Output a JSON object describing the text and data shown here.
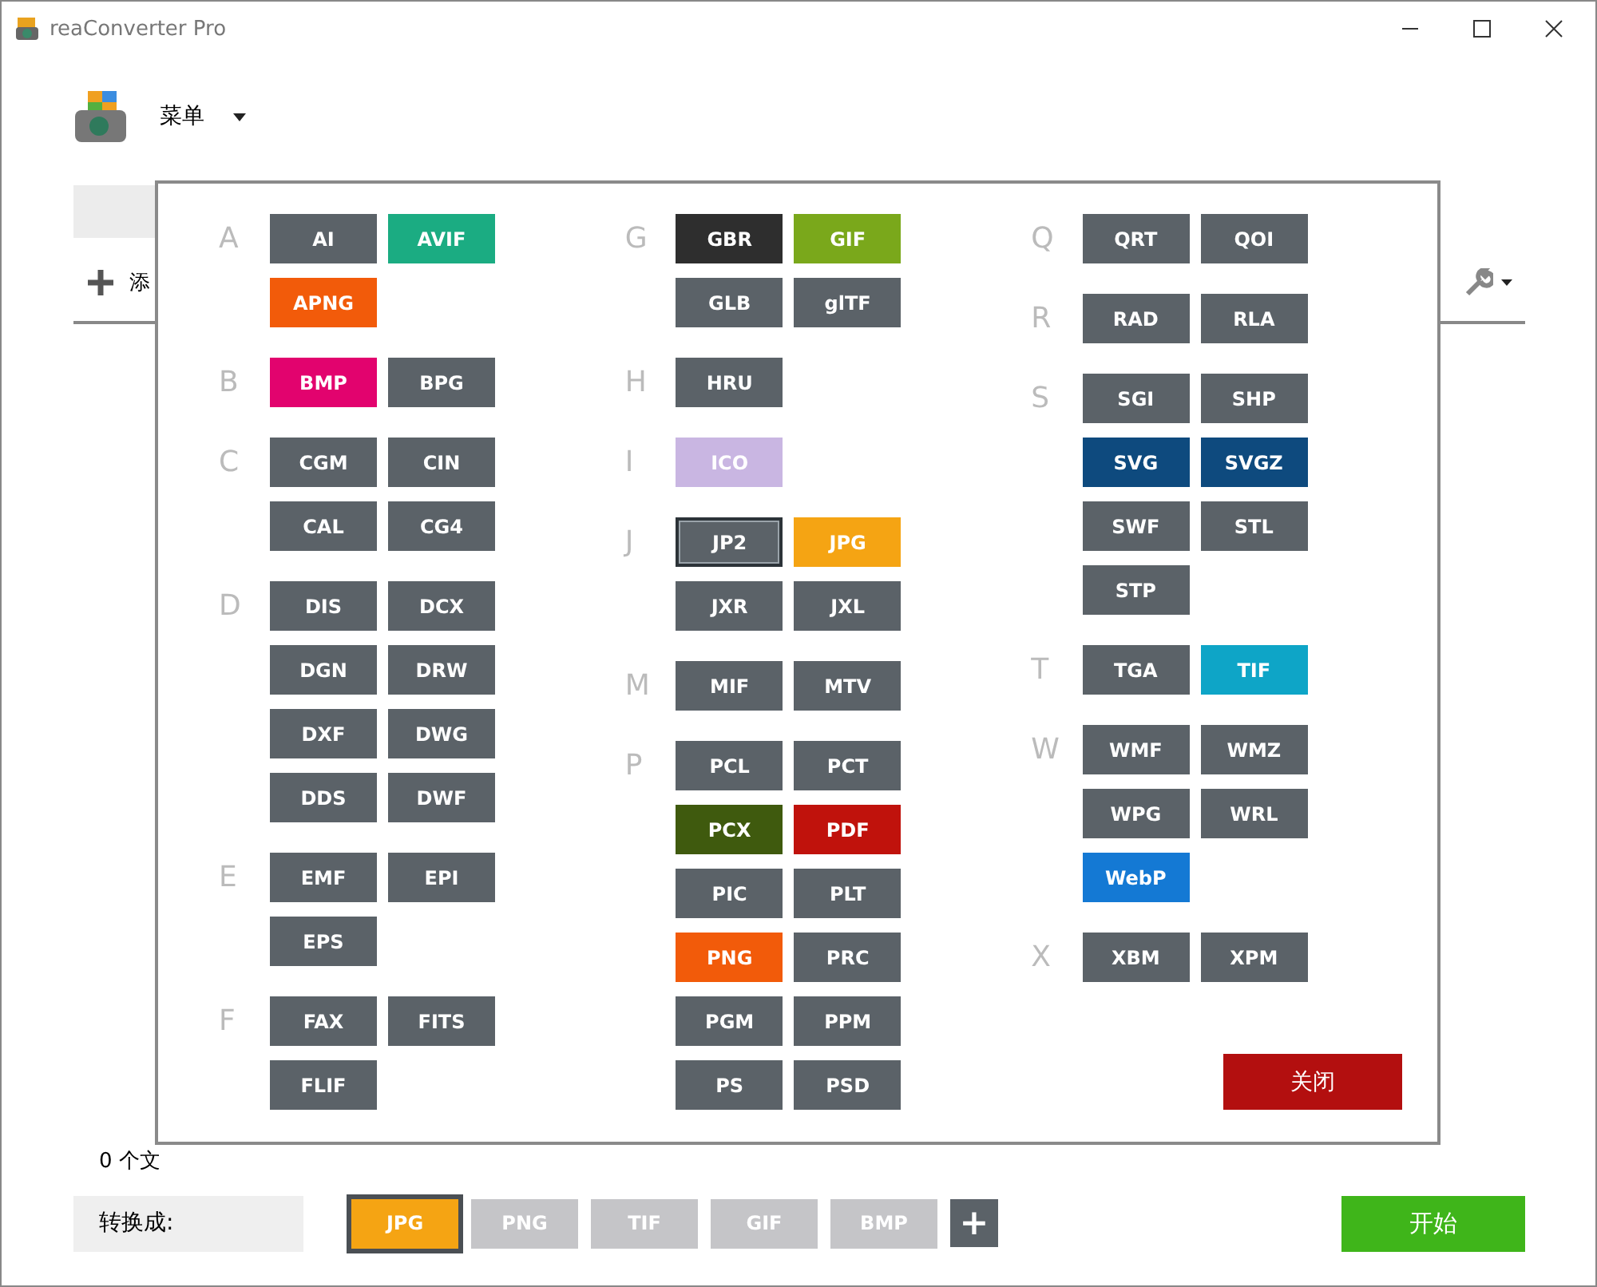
{
  "window": {
    "title": "reaConverter Pro"
  },
  "menu": {
    "label": "菜单"
  },
  "toolbar": {
    "add_label": "添"
  },
  "status": {
    "text": "0 个文"
  },
  "popup": {
    "columns": [
      [
        {
          "letter": "A",
          "formats": [
            {
              "label": "AI",
              "color": "#5b6268",
              "selected": false
            },
            {
              "label": "AVIF",
              "color": "#1bac82",
              "selected": false
            },
            {
              "label": "APNG",
              "color": "#f25b0a",
              "selected": false
            }
          ]
        },
        {
          "letter": "B",
          "formats": [
            {
              "label": "BMP",
              "color": "#e2036e",
              "selected": false
            },
            {
              "label": "BPG",
              "color": "#5b6268",
              "selected": false
            }
          ]
        },
        {
          "letter": "C",
          "formats": [
            {
              "label": "CGM",
              "color": "#5b6268",
              "selected": false
            },
            {
              "label": "CIN",
              "color": "#5b6268",
              "selected": false
            },
            {
              "label": "CAL",
              "color": "#5b6268",
              "selected": false
            },
            {
              "label": "CG4",
              "color": "#5b6268",
              "selected": false
            }
          ]
        },
        {
          "letter": "D",
          "formats": [
            {
              "label": "DIS",
              "color": "#5b6268",
              "selected": false
            },
            {
              "label": "DCX",
              "color": "#5b6268",
              "selected": false
            },
            {
              "label": "DGN",
              "color": "#5b6268",
              "selected": false
            },
            {
              "label": "DRW",
              "color": "#5b6268",
              "selected": false
            },
            {
              "label": "DXF",
              "color": "#5b6268",
              "selected": false
            },
            {
              "label": "DWG",
              "color": "#5b6268",
              "selected": false
            },
            {
              "label": "DDS",
              "color": "#5b6268",
              "selected": false
            },
            {
              "label": "DWF",
              "color": "#5b6268",
              "selected": false
            }
          ]
        },
        {
          "letter": "E",
          "formats": [
            {
              "label": "EMF",
              "color": "#5b6268",
              "selected": false
            },
            {
              "label": "EPI",
              "color": "#5b6268",
              "selected": false
            },
            {
              "label": "EPS",
              "color": "#5b6268",
              "selected": false
            }
          ]
        },
        {
          "letter": "F",
          "formats": [
            {
              "label": "FAX",
              "color": "#5b6268",
              "selected": false
            },
            {
              "label": "FITS",
              "color": "#5b6268",
              "selected": false
            },
            {
              "label": "FLIF",
              "color": "#5b6268",
              "selected": false
            }
          ]
        }
      ],
      [
        {
          "letter": "G",
          "formats": [
            {
              "label": "GBR",
              "color": "#2e2e2e",
              "selected": false
            },
            {
              "label": "GIF",
              "color": "#7aa81b",
              "selected": false
            },
            {
              "label": "GLB",
              "color": "#5b6268",
              "selected": false
            },
            {
              "label": "glTF",
              "color": "#5b6268",
              "selected": false
            }
          ]
        },
        {
          "letter": "H",
          "formats": [
            {
              "label": "HRU",
              "color": "#5b6268",
              "selected": false
            }
          ]
        },
        {
          "letter": "I",
          "formats": [
            {
              "label": "ICO",
              "color": "#c9b6e2",
              "selected": false
            }
          ]
        },
        {
          "letter": "J",
          "formats": [
            {
              "label": "JP2",
              "color": "#5b6268",
              "selected": true
            },
            {
              "label": "JPG",
              "color": "#f5a413",
              "selected": false
            },
            {
              "label": "JXR",
              "color": "#5b6268",
              "selected": false
            },
            {
              "label": "JXL",
              "color": "#5b6268",
              "selected": false
            }
          ]
        },
        {
          "letter": "M",
          "formats": [
            {
              "label": "MIF",
              "color": "#5b6268",
              "selected": false
            },
            {
              "label": "MTV",
              "color": "#5b6268",
              "selected": false
            }
          ]
        },
        {
          "letter": "P",
          "formats": [
            {
              "label": "PCL",
              "color": "#5b6268",
              "selected": false
            },
            {
              "label": "PCT",
              "color": "#5b6268",
              "selected": false
            },
            {
              "label": "PCX",
              "color": "#3f5a0e",
              "selected": false
            },
            {
              "label": "PDF",
              "color": "#c0120c",
              "selected": false
            },
            {
              "label": "PIC",
              "color": "#5b6268",
              "selected": false
            },
            {
              "label": "PLT",
              "color": "#5b6268",
              "selected": false
            },
            {
              "label": "PNG",
              "color": "#f25b0a",
              "selected": false
            },
            {
              "label": "PRC",
              "color": "#5b6268",
              "selected": false
            },
            {
              "label": "PGM",
              "color": "#5b6268",
              "selected": false
            },
            {
              "label": "PPM",
              "color": "#5b6268",
              "selected": false
            },
            {
              "label": "PS",
              "color": "#5b6268",
              "selected": false
            },
            {
              "label": "PSD",
              "color": "#5b6268",
              "selected": false
            }
          ]
        }
      ],
      [
        {
          "letter": "Q",
          "formats": [
            {
              "label": "QRT",
              "color": "#5b6268",
              "selected": false
            },
            {
              "label": "QOI",
              "color": "#5b6268",
              "selected": false
            }
          ]
        },
        {
          "letter": "R",
          "formats": [
            {
              "label": "RAD",
              "color": "#5b6268",
              "selected": false
            },
            {
              "label": "RLA",
              "color": "#5b6268",
              "selected": false
            }
          ]
        },
        {
          "letter": "S",
          "formats": [
            {
              "label": "SGI",
              "color": "#5b6268",
              "selected": false
            },
            {
              "label": "SHP",
              "color": "#5b6268",
              "selected": false
            },
            {
              "label": "SVG",
              "color": "#0e4a7e",
              "selected": false
            },
            {
              "label": "SVGZ",
              "color": "#0e4a7e",
              "selected": false
            },
            {
              "label": "SWF",
              "color": "#5b6268",
              "selected": false
            },
            {
              "label": "STL",
              "color": "#5b6268",
              "selected": false
            },
            {
              "label": "STP",
              "color": "#5b6268",
              "selected": false
            }
          ]
        },
        {
          "letter": "T",
          "formats": [
            {
              "label": "TGA",
              "color": "#5b6268",
              "selected": false
            },
            {
              "label": "TIF",
              "color": "#0ea5c7",
              "selected": false
            }
          ]
        },
        {
          "letter": "W",
          "formats": [
            {
              "label": "WMF",
              "color": "#5b6268",
              "selected": false
            },
            {
              "label": "WMZ",
              "color": "#5b6268",
              "selected": false
            },
            {
              "label": "WPG",
              "color": "#5b6268",
              "selected": false
            },
            {
              "label": "WRL",
              "color": "#5b6268",
              "selected": false
            },
            {
              "label": "WebP",
              "color": "#1479d4",
              "selected": false
            }
          ]
        },
        {
          "letter": "X",
          "formats": [
            {
              "label": "XBM",
              "color": "#5b6268",
              "selected": false
            },
            {
              "label": "XPM",
              "color": "#5b6268",
              "selected": false
            }
          ]
        }
      ]
    ],
    "close_label": "关闭"
  },
  "convert": {
    "label": "转换成:",
    "targets": [
      {
        "label": "JPG",
        "selected": true
      },
      {
        "label": "PNG",
        "selected": false
      },
      {
        "label": "TIF",
        "selected": false
      },
      {
        "label": "GIF",
        "selected": false
      },
      {
        "label": "BMP",
        "selected": false
      }
    ],
    "add": "+",
    "start": "开始"
  }
}
